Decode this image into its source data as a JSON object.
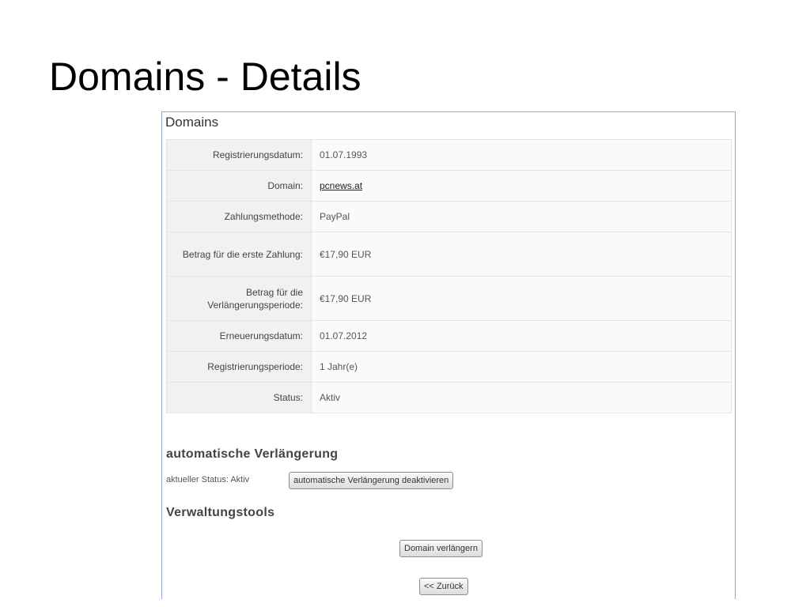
{
  "slide": {
    "title": "Domains - Details"
  },
  "panel": {
    "heading": "Domains",
    "rows": [
      {
        "label": "Registrierungsdatum:",
        "value": "01.07.1993"
      },
      {
        "label": "Domain:",
        "value": "pcnews.at"
      },
      {
        "label": "Zahlungsmethode:",
        "value": "PayPal"
      },
      {
        "label": "Betrag für die erste Zahlung:",
        "value": "€17,90 EUR"
      },
      {
        "label": "Betrag für die Verlängerungsperiode:",
        "value": "€17,90 EUR"
      },
      {
        "label": "Erneuerungsdatum:",
        "value": "01.07.2012"
      },
      {
        "label": "Registrierungsperiode:",
        "value": "1 Jahr(e)"
      },
      {
        "label": "Status:",
        "value": "Aktiv"
      }
    ]
  },
  "autorenew": {
    "heading": "automatische Verlängerung",
    "status_text": "aktueller Status: Aktiv",
    "toggle_label": "automatische Verlängerung deaktivieren"
  },
  "tools": {
    "heading": "Verwaltungstools",
    "renew_label": "Domain verlängern",
    "back_label": "<< Zurück"
  }
}
